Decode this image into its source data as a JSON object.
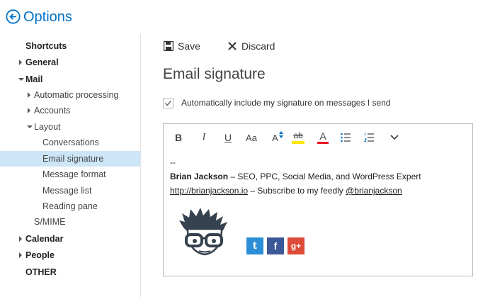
{
  "header": {
    "title": "Options"
  },
  "sidebar": {
    "items": [
      {
        "label": "Shortcuts"
      },
      {
        "label": "General"
      },
      {
        "label": "Mail"
      },
      {
        "label": "Automatic processing"
      },
      {
        "label": "Accounts"
      },
      {
        "label": "Layout"
      },
      {
        "label": "Conversations"
      },
      {
        "label": "Email signature"
      },
      {
        "label": "Message format"
      },
      {
        "label": "Message list"
      },
      {
        "label": "Reading pane"
      },
      {
        "label": "S/MIME"
      },
      {
        "label": "Calendar"
      },
      {
        "label": "People"
      },
      {
        "label": "OTHER"
      }
    ],
    "selected": "Email signature"
  },
  "toolbar": {
    "save_label": "Save",
    "discard_label": "Discard"
  },
  "main": {
    "title": "Email signature",
    "auto_include_label": "Automatically include my signature on messages I send",
    "auto_include_checked": true
  },
  "editor": {
    "format_buttons": {
      "bold": "B",
      "italic": "I",
      "underline": "U",
      "font_size": "Aa",
      "grow_font": "A",
      "highlight": "ab",
      "font_color": "A"
    },
    "highlight_color": "#ffe600",
    "font_color_swatch": "#e81123",
    "signature": {
      "dashes": "--",
      "name": "Brian Jackson",
      "tagline": " – SEO, PPC, Social Media, and WordPress Expert",
      "link": "http://brianjackson.io",
      "subscribe": " – Subscribe to my feedly ",
      "handle": "@brianjackson"
    },
    "social": {
      "twitter": "t",
      "facebook": "f",
      "googleplus": "g+"
    }
  },
  "colors": {
    "accent": "#0072c6",
    "selected_bg": "#cde6f7",
    "twitter": "#2a8fd6",
    "facebook": "#3b5998",
    "googleplus": "#dd4b39"
  }
}
